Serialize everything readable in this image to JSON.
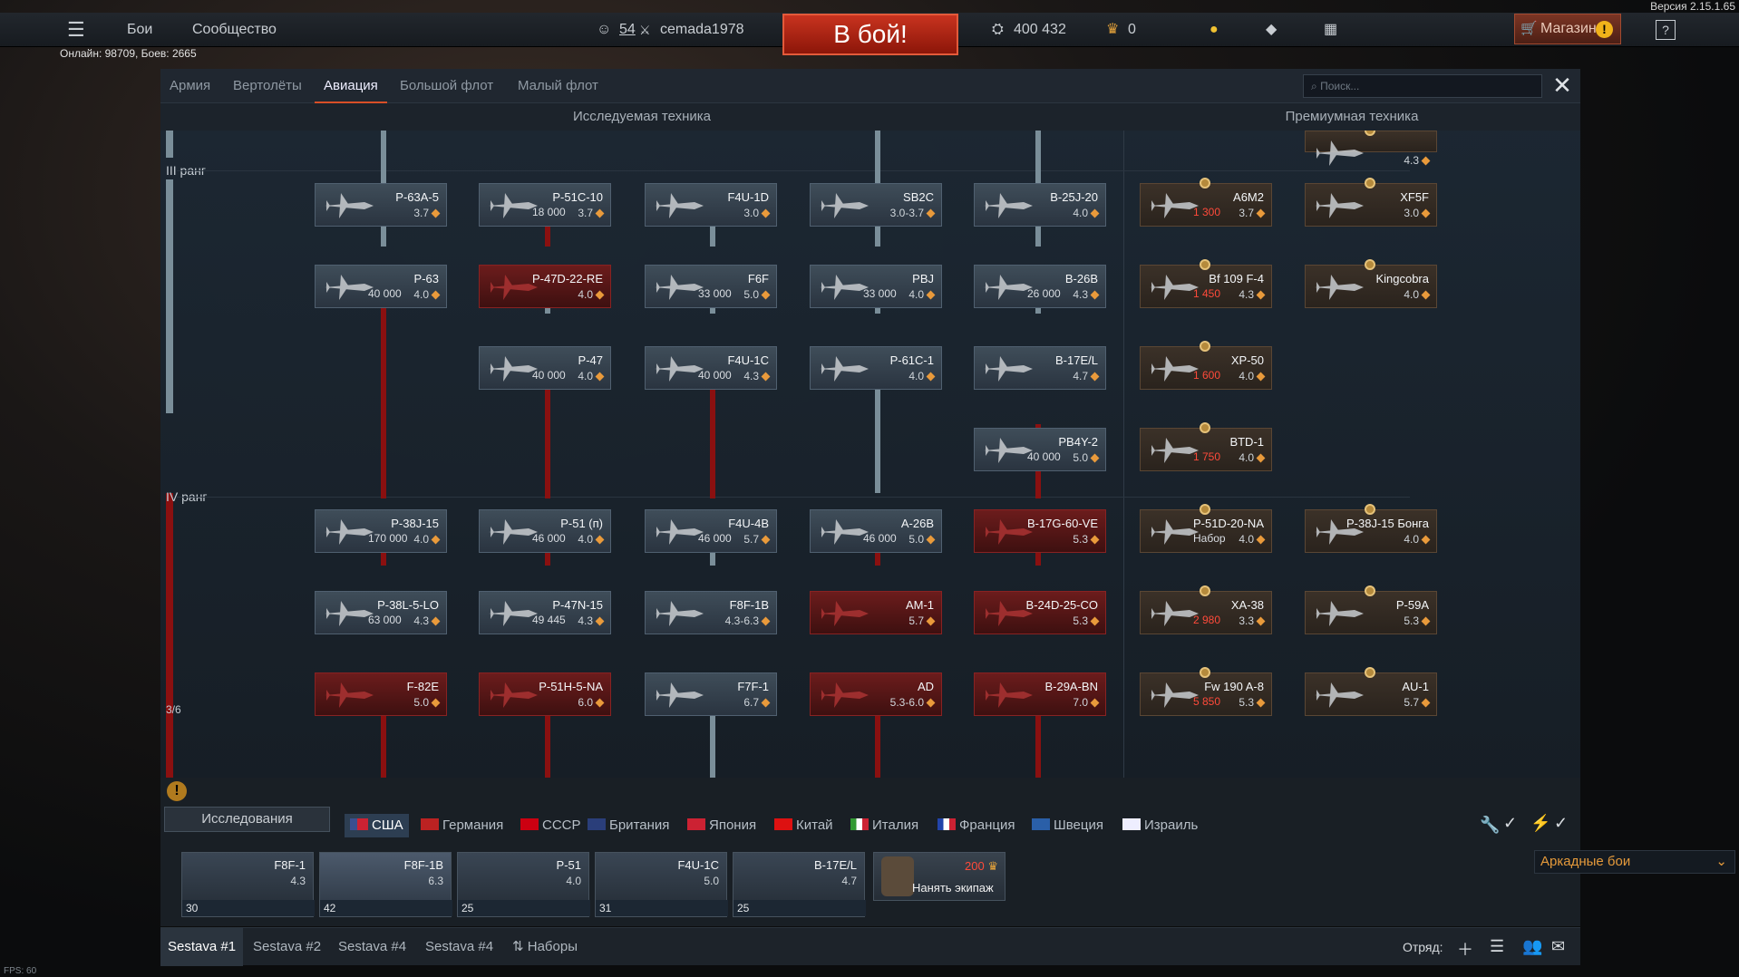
{
  "version": "Версия 2.15.1.65",
  "topbar": {
    "menu_items": [
      "Бои",
      "Сообщество"
    ],
    "player_level": "54",
    "player_name": "cemada1978",
    "battle_button": "В бой!",
    "silver_lions": "400 432",
    "golden_eagles": "0",
    "shop_label": "Магазин",
    "help": "?"
  },
  "online": "Онлайн: 98709, Боев: 2665",
  "tabs": [
    "Армия",
    "Вертолёты",
    "Авиация",
    "Большой флот",
    "Малый флот"
  ],
  "active_tab": "Авиация",
  "search_placeholder": "Поиск...",
  "columns": {
    "researchable": "Исследуемая техника",
    "premium": "Премиумная техника"
  },
  "ranks": {
    "r3": "III ранг",
    "r4": "IV ранг",
    "progress": "3/6"
  },
  "tree_cards": [
    {
      "name": "P-63A-5",
      "br": "3.7",
      "cost": ""
    },
    {
      "name": "P-51C-10",
      "br": "3.7",
      "cost": "18 000"
    },
    {
      "name": "F4U-1D",
      "br": "3.0",
      "cost": ""
    },
    {
      "name": "SB2C",
      "br": "3.0-3.7",
      "cost": ""
    },
    {
      "name": "B-25J-20",
      "br": "4.0",
      "cost": ""
    },
    {
      "name": "P-63",
      "br": "4.0",
      "cost": "40 000"
    },
    {
      "name": "P-47D-22-RE",
      "br": "4.0",
      "cost": ""
    },
    {
      "name": "F6F",
      "br": "5.0",
      "cost": "33 000"
    },
    {
      "name": "PBJ",
      "br": "4.0",
      "cost": "33 000"
    },
    {
      "name": "B-26B",
      "br": "4.3",
      "cost": "26 000"
    },
    {
      "name": "P-47",
      "br": "4.0",
      "cost": "40 000"
    },
    {
      "name": "F4U-1C",
      "br": "4.3",
      "cost": "40 000"
    },
    {
      "name": "P-61C-1",
      "br": "4.0",
      "cost": ""
    },
    {
      "name": "B-17E/L",
      "br": "4.7",
      "cost": ""
    },
    {
      "name": "PB4Y-2",
      "br": "5.0",
      "cost": "40 000"
    },
    {
      "name": "P-38J-15",
      "br": "4.0",
      "cost": "170 000"
    },
    {
      "name": "P-51 (п)",
      "br": "4.0",
      "cost": "46 000"
    },
    {
      "name": "F4U-4B",
      "br": "5.7",
      "cost": "46 000"
    },
    {
      "name": "A-26B",
      "br": "5.0",
      "cost": "46 000"
    },
    {
      "name": "B-17G-60-VE",
      "br": "5.3",
      "cost": ""
    },
    {
      "name": "P-38L-5-LO",
      "br": "4.3",
      "cost": "63 000"
    },
    {
      "name": "P-47N-15",
      "br": "4.3",
      "cost": "49 445"
    },
    {
      "name": "F8F-1B",
      "br": "4.3-6.3",
      "cost": ""
    },
    {
      "name": "AM-1",
      "br": "5.7",
      "cost": ""
    },
    {
      "name": "B-24D-25-CO",
      "br": "5.3",
      "cost": ""
    },
    {
      "name": "F-82E",
      "br": "5.0",
      "cost": ""
    },
    {
      "name": "P-51H-5-NA",
      "br": "6.0",
      "cost": ""
    },
    {
      "name": "F7F-1",
      "br": "6.7",
      "cost": ""
    },
    {
      "name": "AD",
      "br": "5.3-6.0",
      "cost": ""
    },
    {
      "name": "B-29A-BN",
      "br": "7.0",
      "cost": ""
    }
  ],
  "premium_cards": [
    {
      "name": "",
      "br": "4.3",
      "cost": ""
    },
    {
      "name": "A6M2",
      "br": "3.7",
      "cost": "1 300"
    },
    {
      "name": "XF5F",
      "br": "3.0",
      "cost": ""
    },
    {
      "name": "Bf 109 F-4",
      "br": "4.3",
      "cost": "1 450"
    },
    {
      "name": "Kingcobra",
      "br": "4.0",
      "cost": ""
    },
    {
      "name": "XP-50",
      "br": "4.0",
      "cost": "1 600"
    },
    {
      "name": "BTD-1",
      "br": "4.0",
      "cost": "1 750"
    },
    {
      "name": "P-51D-20-NA",
      "br": "4.0",
      "cost": "Набор"
    },
    {
      "name": "P-38J-15 Бонга",
      "br": "4.0",
      "cost": ""
    },
    {
      "name": "XA-38",
      "br": "3.3",
      "cost": "2 980"
    },
    {
      "name": "P-59A",
      "br": "5.3",
      "cost": ""
    },
    {
      "name": "Fw 190 A-8",
      "br": "5.3",
      "cost": "5 850"
    },
    {
      "name": "AU-1",
      "br": "5.7",
      "cost": ""
    }
  ],
  "game_mode": "Аркадные бои",
  "research_button": "Исследования",
  "nations": [
    "США",
    "Германия",
    "СССР",
    "Британия",
    "Япония",
    "Китай",
    "Италия",
    "Франция",
    "Швеция",
    "Израиль"
  ],
  "slots": [
    {
      "name": "F8F-1",
      "br": "4.3",
      "crew": "30"
    },
    {
      "name": "F8F-1B",
      "br": "6.3",
      "crew": "42"
    },
    {
      "name": "P-51",
      "br": "4.0",
      "crew": "25"
    },
    {
      "name": "F4U-1C",
      "br": "5.0",
      "crew": "31"
    },
    {
      "name": "B-17E/L",
      "br": "4.7",
      "crew": "25"
    }
  ],
  "hire": {
    "label": "Нанять экипаж",
    "cost": "200"
  },
  "footer_tabs": [
    "Sestava #1",
    "Sestava #2",
    "Sestava #4",
    "Sestava #4",
    "Наборы"
  ],
  "squad_label": "Отряд:",
  "fps": "FPS: 60"
}
